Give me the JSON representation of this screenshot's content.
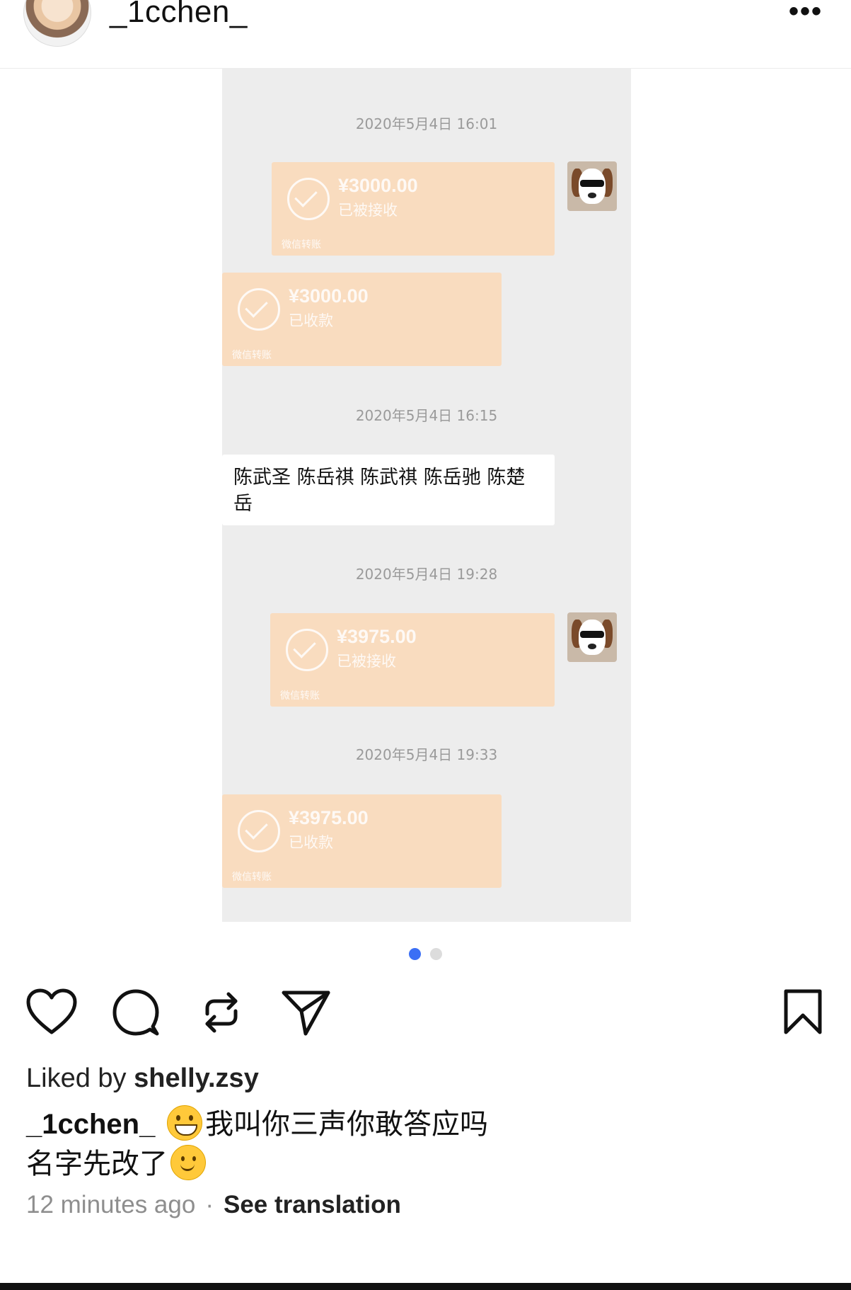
{
  "header": {
    "username": "_1cchen_",
    "more_label": "•••"
  },
  "chat": {
    "timestamps": [
      "2020年5月4日 16:01",
      "2020年5月4日 16:15",
      "2020年5月4日 19:28",
      "2020年5月4日 19:33"
    ],
    "transfers": [
      {
        "amount": "¥3000.00",
        "status": "已被接收",
        "footer": "微信转账"
      },
      {
        "amount": "¥3000.00",
        "status": "已收款",
        "footer": "微信转账"
      },
      {
        "amount": "¥3975.00",
        "status": "已被接收",
        "footer": "微信转账"
      },
      {
        "amount": "¥3975.00",
        "status": "已收款",
        "footer": "微信转账"
      }
    ],
    "message_line1": "陈武圣 陈岳祺 陈武祺 陈岳驰 陈楚",
    "message_line2": "岳"
  },
  "carousel": {
    "current_page": 1,
    "total_pages": 2
  },
  "actions": {
    "like_icon": "heart-icon",
    "comment_icon": "comment-icon",
    "repost_icon": "repost-icon",
    "share_icon": "send-icon",
    "save_icon": "bookmark-icon"
  },
  "post": {
    "liked_by_prefix": "Liked by ",
    "liked_by_user": "shelly.zsy",
    "caption_user": "_1cchen_",
    "caption_line1": "我叫你三声你敢答应吗",
    "caption_line2": "名字先改了",
    "time_ago": "12 minutes ago",
    "separator": "·",
    "translate_label": "See translation"
  },
  "colors": {
    "transfer_bg": "#f9dcbf",
    "chat_bg": "#ededed",
    "active_dot": "#3b6ff5"
  }
}
